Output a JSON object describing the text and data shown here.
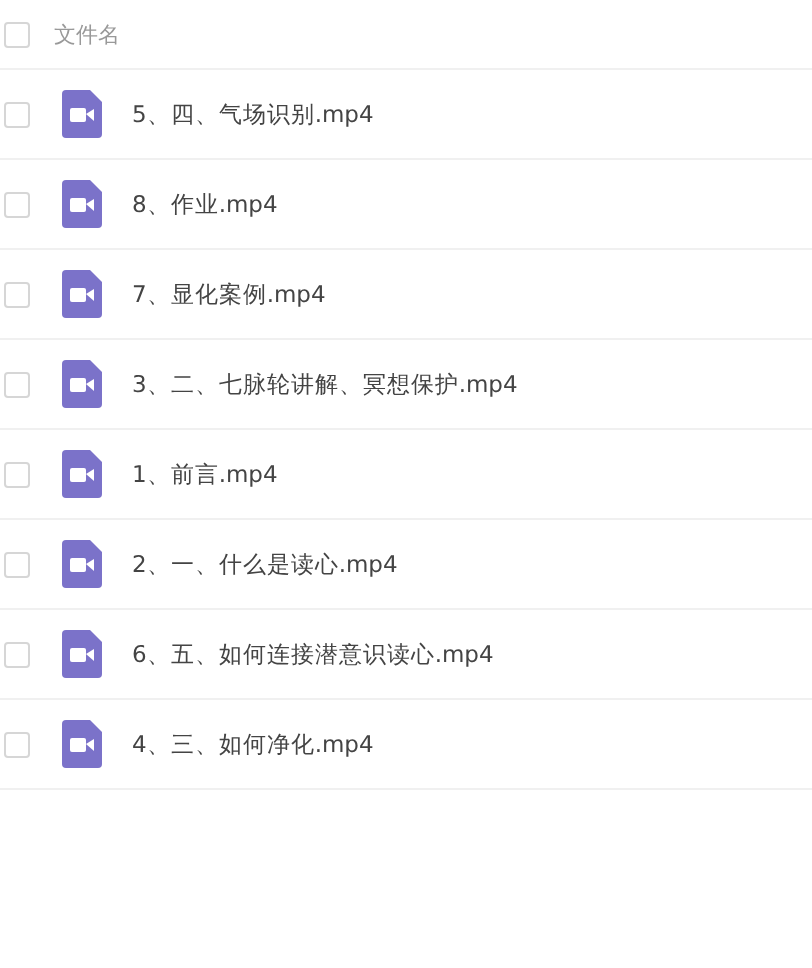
{
  "header": {
    "label": "文件名",
    "checked": false
  },
  "files": [
    {
      "name": "5、四、气场识别.mp4",
      "checked": false
    },
    {
      "name": "8、作业.mp4",
      "checked": false
    },
    {
      "name": "7、显化案例.mp4",
      "checked": false
    },
    {
      "name": "3、二、七脉轮讲解、冥想保护.mp4",
      "checked": false
    },
    {
      "name": "1、前言.mp4",
      "checked": false
    },
    {
      "name": "2、一、什么是读心.mp4",
      "checked": false
    },
    {
      "name": "6、五、如何连接潜意识读心.mp4",
      "checked": false
    },
    {
      "name": "4、三、如何净化.mp4",
      "checked": false
    }
  ]
}
